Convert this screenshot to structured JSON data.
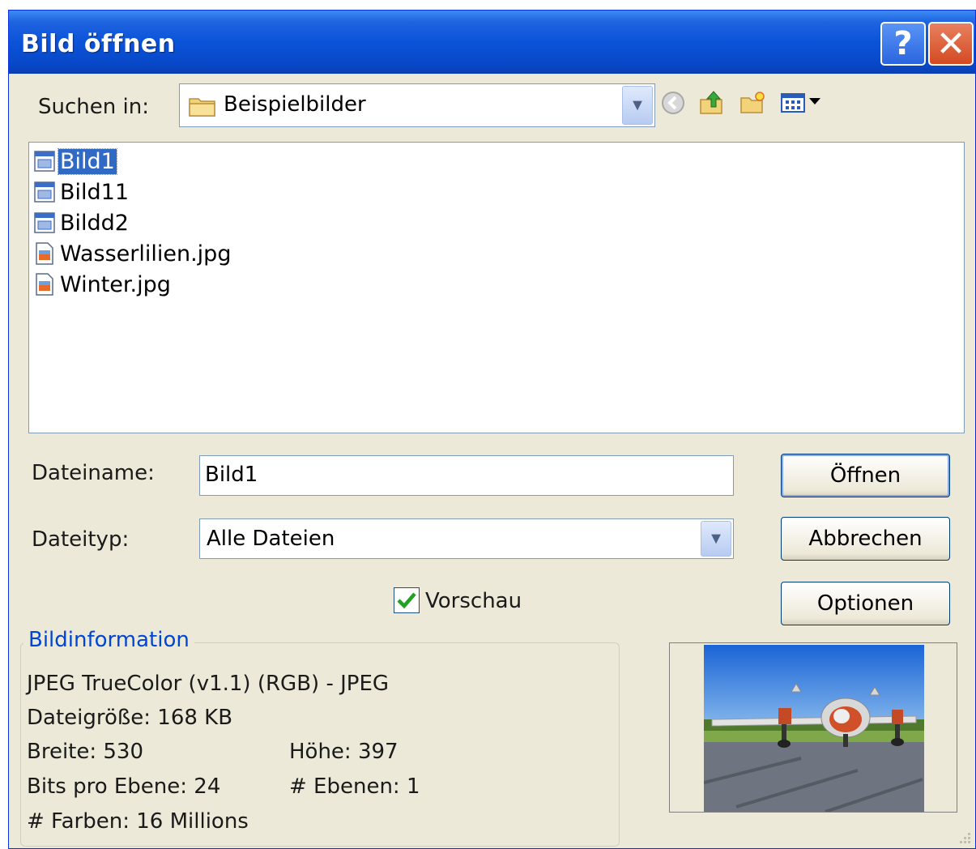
{
  "window": {
    "title": "Bild öffnen",
    "help_symbol": "?",
    "close_symbol": "✕"
  },
  "lookin": {
    "label": "Suchen in:",
    "value": "Beispielbilder",
    "icon": "folder-icon"
  },
  "toolbar": {
    "icons": [
      "back-icon",
      "up-folder-icon",
      "new-folder-icon",
      "view-menu-icon"
    ]
  },
  "files": [
    {
      "name": "Bild1",
      "icon": "image-document-icon",
      "selected": true
    },
    {
      "name": "Bild11",
      "icon": "image-document-icon",
      "selected": false
    },
    {
      "name": "Bildd2",
      "icon": "image-document-icon",
      "selected": false
    },
    {
      "name": "Wasserlilien.jpg",
      "icon": "jpg-file-icon",
      "selected": false
    },
    {
      "name": "Winter.jpg",
      "icon": "jpg-file-icon",
      "selected": false
    }
  ],
  "filename": {
    "label": "Dateiname:",
    "value": "Bild1"
  },
  "filetype": {
    "label": "Dateityp:",
    "value": "Alle Dateien"
  },
  "buttons": {
    "open": "Öffnen",
    "cancel": "Abbrechen",
    "options": "Optionen"
  },
  "preview_toggle": {
    "label": "Vorschau",
    "checked": true
  },
  "imageinfo": {
    "title": "Bildinformation",
    "format": "JPEG TrueColor (v1.1) (RGB) - JPEG",
    "filesize": "Dateigröße: 168 KB",
    "width": "Breite: 530",
    "height": "Höhe: 397",
    "bits": "Bits pro Ebene: 24",
    "layers": "# Ebenen: 1",
    "colors": "# Farben: 16 Millions"
  },
  "preview": {
    "icon": "airplane-photo-thumbnail"
  },
  "colors": {
    "titlebar": "#0a53d8",
    "dialog_bg": "#ece9d8",
    "selection": "#316ac5",
    "group_title": "#0046d5"
  }
}
